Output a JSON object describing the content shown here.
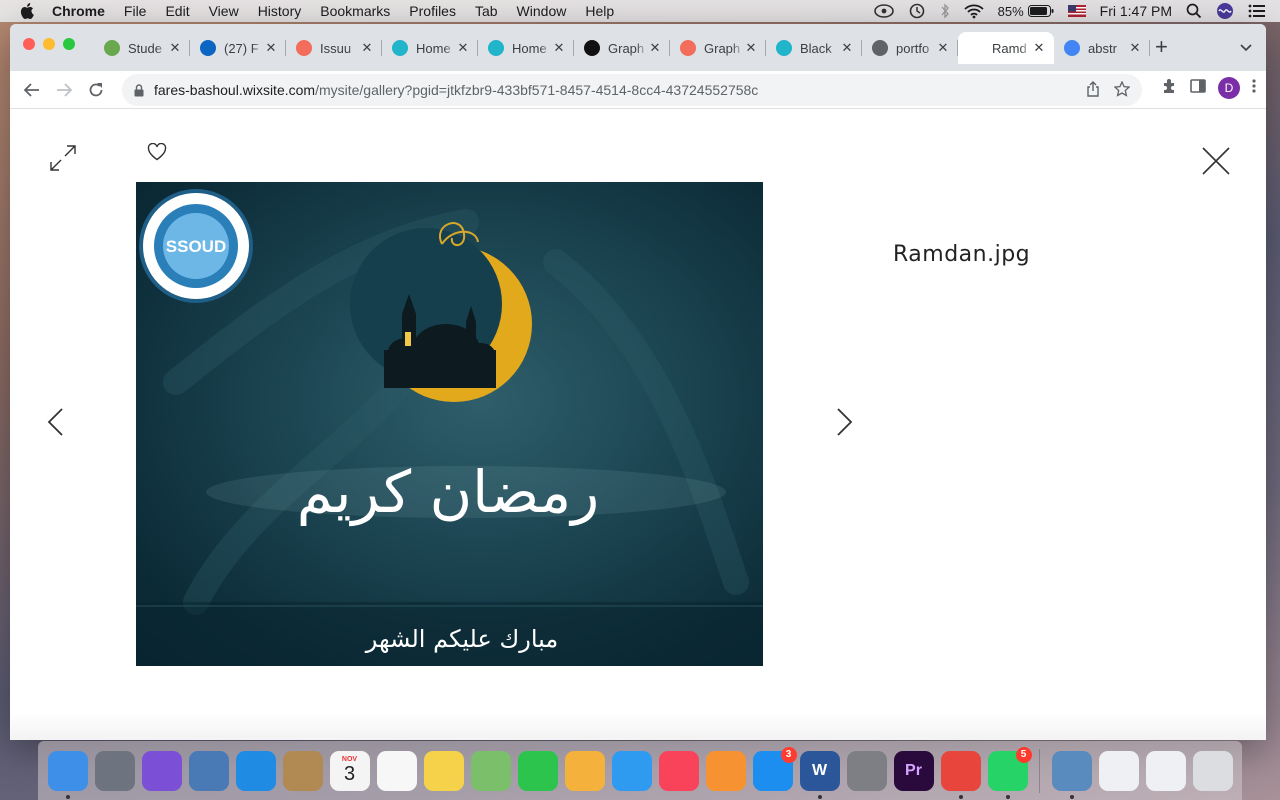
{
  "menubar": {
    "app": "Chrome",
    "items": [
      "File",
      "Edit",
      "View",
      "History",
      "Bookmarks",
      "Profiles",
      "Tab",
      "Window",
      "Help"
    ],
    "battery": "85%",
    "clock": "Fri 1:47 PM"
  },
  "tabs": [
    {
      "title": "Stude",
      "favicon": "leaf-icon",
      "color": "#6aa84f"
    },
    {
      "title": "(27) F",
      "favicon": "linkedin-icon",
      "color": "#0a66c2"
    },
    {
      "title": "Issuu",
      "favicon": "issuu-icon",
      "color": "#f36d5d"
    },
    {
      "title": "Home",
      "favicon": "canva-icon",
      "color": "#20b5c8"
    },
    {
      "title": "Home",
      "favicon": "canva-icon",
      "color": "#20b5c8"
    },
    {
      "title": "Graph",
      "favicon": "studocu-icon",
      "color": "#111111"
    },
    {
      "title": "Graph",
      "favicon": "issuu-icon",
      "color": "#f36d5d"
    },
    {
      "title": "Black",
      "favicon": "canva-icon",
      "color": "#20b5c8"
    },
    {
      "title": "portfo",
      "favicon": "globe-icon",
      "color": "#5f6368"
    },
    {
      "title": "Ramd",
      "favicon": "wix-icon",
      "color": "#ffffff",
      "active": true
    },
    {
      "title": "abstr",
      "favicon": "google-icon",
      "color": "#4285f4"
    }
  ],
  "address": {
    "host": "fares-bashoul.wixsite.com",
    "path": "/mysite/gallery?pgid=jtkfzbr9-433bf571-8457-4514-8cc4-43724552758c"
  },
  "profile_initial": "D",
  "viewer": {
    "filename": "Ramdan.jpg",
    "logo_text": "SSOUD",
    "arabic_title": "رمضان كريم",
    "arabic_subtitle": "مبارك عليكم الشهر"
  },
  "dock": {
    "apps": [
      {
        "name": "finder-icon",
        "color": "#3d8fe8"
      },
      {
        "name": "launchpad-icon",
        "color": "#6d7480"
      },
      {
        "name": "siri-icon",
        "color": "#7b4fd6"
      },
      {
        "name": "preview-icon",
        "color": "#4a7ab5"
      },
      {
        "name": "safari-icon",
        "color": "#1f8be3"
      },
      {
        "name": "contacts-icon",
        "color": "#b08a52"
      },
      {
        "name": "calendar-icon",
        "color": "#f4f4f4"
      },
      {
        "name": "reminders-icon",
        "color": "#f7f7f7"
      },
      {
        "name": "notes-icon",
        "color": "#f5d24a"
      },
      {
        "name": "maps-icon",
        "color": "#7bbf6a"
      },
      {
        "name": "facetime-icon",
        "color": "#2dc44d"
      },
      {
        "name": "photos-icon",
        "color": "#f4b23c"
      },
      {
        "name": "messages-icon",
        "color": "#2f9bf0"
      },
      {
        "name": "music-icon",
        "color": "#f9435b"
      },
      {
        "name": "books-icon",
        "color": "#f79232"
      },
      {
        "name": "appstore-icon",
        "color": "#1c8ef0"
      },
      {
        "name": "word-icon",
        "color": "#2b579a"
      },
      {
        "name": "system-preferences-icon",
        "color": "#7e7e85"
      },
      {
        "name": "premiere-icon",
        "color": "#2a0a3d"
      },
      {
        "name": "chrome-icon",
        "color": "#e8453c"
      },
      {
        "name": "whatsapp-icon",
        "color": "#25d366"
      },
      {
        "name": "preview-photos-icon",
        "color": "#5a8bbf"
      }
    ],
    "calendar_month": "NOV",
    "calendar_day": "3",
    "appstore_badge": "3",
    "whatsapp_badge": "5",
    "word_label": "W",
    "premiere_label": "Pr"
  }
}
